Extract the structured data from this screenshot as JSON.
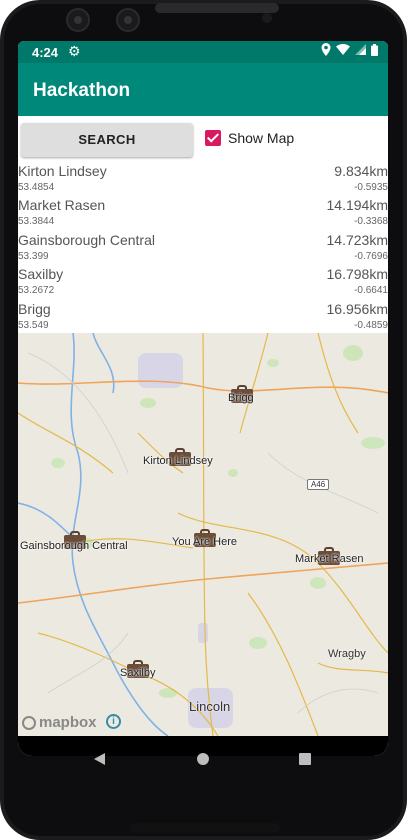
{
  "status": {
    "time": "4:24"
  },
  "app": {
    "title": "Hackathon"
  },
  "controls": {
    "search_label": "SEARCH",
    "show_map_label": "Show Map",
    "show_map_checked": true
  },
  "results": [
    {
      "name": "Kirton Lindsey",
      "distance": "9.834km",
      "lat": "53.4854",
      "lon": "-0.5935"
    },
    {
      "name": "Market Rasen",
      "distance": "14.194km",
      "lat": "53.3844",
      "lon": "-0.3368"
    },
    {
      "name": "Gainsborough Central",
      "distance": "14.723km",
      "lat": "53.399",
      "lon": "-0.7696"
    },
    {
      "name": "Saxilby",
      "distance": "16.798km",
      "lat": "53.2672",
      "lon": "-0.6641"
    },
    {
      "name": "Brigg",
      "distance": "16.956km",
      "lat": "53.549",
      "lon": "-0.4859"
    }
  ],
  "map": {
    "markers": {
      "brigg": "Brigg",
      "kirton": "Kirton Lindsey",
      "gainsborough": "Gainsborough Central",
      "here": "You Are Here",
      "market_rasen": "Market Rasen",
      "saxilby": "Saxilby"
    },
    "places": {
      "wragby": "Wragby",
      "lincoln": "Lincoln"
    },
    "road": "A46",
    "attribution": "mapbox"
  },
  "colors": {
    "primary": "#00897b",
    "primary_dark": "#00796b",
    "accent": "#d81b60",
    "marker": "#6b4e3a"
  }
}
